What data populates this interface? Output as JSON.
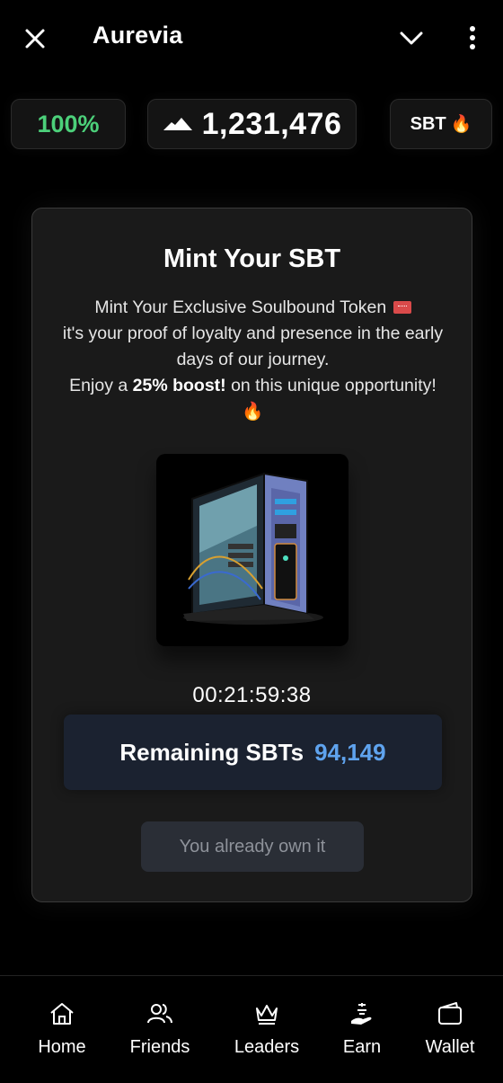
{
  "header": {
    "title": "Aurevia"
  },
  "stats": {
    "percent": "100%",
    "score": "1,231,476",
    "sbt_label": "SBT",
    "sbt_emoji": "🔥"
  },
  "card": {
    "title": "Mint Your SBT",
    "desc_line1": "Mint Your Exclusive Soulbound Token",
    "desc_line2": "it's your proof of loyalty and presence in the early days of our journey.",
    "desc_enjoy": "Enjoy a",
    "desc_boost": "25% boost!",
    "desc_tail": "on this unique opportunity!",
    "desc_emoji": "🔥",
    "timer": "00:21:59:38",
    "remaining_label": "Remaining SBTs",
    "remaining_value": "94,149",
    "own_button": "You already own it"
  },
  "nav": {
    "items": [
      {
        "label": "Home",
        "icon": "home-icon"
      },
      {
        "label": "Friends",
        "icon": "friends-icon"
      },
      {
        "label": "Leaders",
        "icon": "crown-icon"
      },
      {
        "label": "Earn",
        "icon": "earn-icon"
      },
      {
        "label": "Wallet",
        "icon": "wallet-icon"
      }
    ]
  },
  "colors": {
    "background": "#000000",
    "percent_green": "#4cd07a",
    "remaining_blue": "#5fa3ee",
    "card_bg": "#1a1a1a"
  }
}
